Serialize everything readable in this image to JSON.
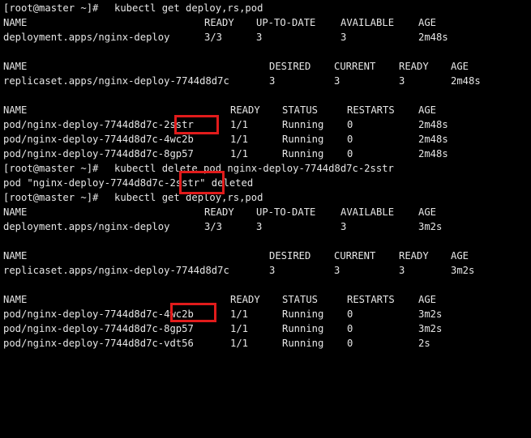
{
  "terminal": {
    "line_1": {
      "prompt": "[root@master ~]#",
      "command": "kubectl get deploy,rs,pod"
    },
    "deploy_header_1": {
      "name": "NAME",
      "ready": "READY",
      "uptodate": "UP-TO-DATE",
      "available": "AVAILABLE",
      "age": "AGE"
    },
    "deploy_row_1": {
      "name": "deployment.apps/nginx-deploy",
      "ready": "3/3",
      "uptodate": "3",
      "available": "3",
      "age": "2m48s"
    },
    "rs_header_1": {
      "name": "NAME",
      "desired": "DESIRED",
      "current": "CURRENT",
      "ready": "READY",
      "age": "AGE"
    },
    "rs_row_1": {
      "name": "replicaset.apps/nginx-deploy-7744d8d7c",
      "desired": "3",
      "current": "3",
      "ready": "3",
      "age": "2m48s"
    },
    "pod_header_1": {
      "name": "NAME",
      "ready": "READY",
      "status": "STATUS",
      "restarts": "RESTARTS",
      "age": "AGE"
    },
    "pod_rows_1": [
      {
        "name": "pod/nginx-deploy-7744d8d7c-2sstr",
        "ready": "1/1",
        "status": "Running",
        "restarts": "0",
        "age": "2m48s"
      },
      {
        "name": "pod/nginx-deploy-7744d8d7c-4wc2b",
        "ready": "1/1",
        "status": "Running",
        "restarts": "0",
        "age": "2m48s"
      },
      {
        "name": "pod/nginx-deploy-7744d8d7c-8gp57",
        "ready": "1/1",
        "status": "Running",
        "restarts": "0",
        "age": "2m48s"
      }
    ],
    "line_delete": {
      "prompt": "[root@master ~]#",
      "command": "kubectl delete pod nginx-deploy-7744d8d7c-2sstr"
    },
    "line_deleted": {
      "text": "pod \"nginx-deploy-7744d8d7c-2sstr\" deleted"
    },
    "line_2": {
      "prompt": "[root@master ~]#",
      "command": "kubectl get deploy,rs,pod"
    },
    "deploy_header_2": {
      "name": "NAME",
      "ready": "READY",
      "uptodate": "UP-TO-DATE",
      "available": "AVAILABLE",
      "age": "AGE"
    },
    "deploy_row_2": {
      "name": "deployment.apps/nginx-deploy",
      "ready": "3/3",
      "uptodate": "3",
      "available": "3",
      "age": "3m2s"
    },
    "rs_header_2": {
      "name": "NAME",
      "desired": "DESIRED",
      "current": "CURRENT",
      "ready": "READY",
      "age": "AGE"
    },
    "rs_row_2": {
      "name": "replicaset.apps/nginx-deploy-7744d8d7c",
      "desired": "3",
      "current": "3",
      "ready": "3",
      "age": "3m2s"
    },
    "pod_header_2": {
      "name": "NAME",
      "ready": "READY",
      "status": "STATUS",
      "restarts": "RESTARTS",
      "age": "AGE"
    },
    "pod_rows_2": [
      {
        "name": "pod/nginx-deploy-7744d8d7c-4wc2b",
        "ready": "1/1",
        "status": "Running",
        "restarts": "0",
        "age": "3m2s"
      },
      {
        "name": "pod/nginx-deploy-7744d8d7c-8gp57",
        "ready": "1/1",
        "status": "Running",
        "restarts": "0",
        "age": "3m2s"
      },
      {
        "name": "pod/nginx-deploy-7744d8d7c-vdt56",
        "ready": "1/1",
        "status": "Running",
        "restarts": "0",
        "age": "2s"
      }
    ]
  },
  "colors": {
    "background": "#000000",
    "text": "#e6e6e6",
    "highlight_box": "#e11b1b"
  }
}
